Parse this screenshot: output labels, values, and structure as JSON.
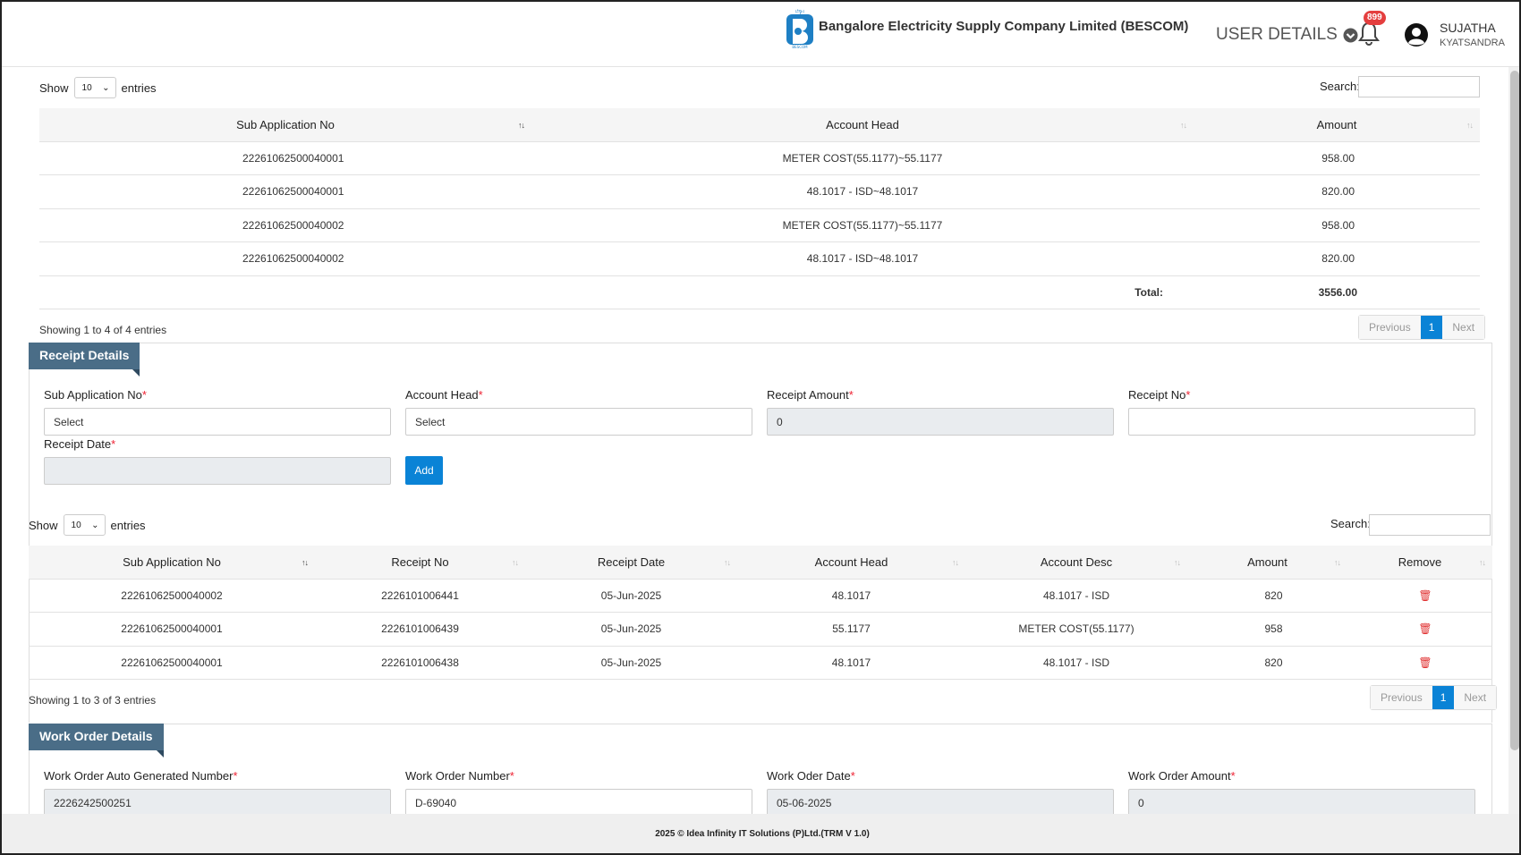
{
  "header": {
    "company": "Bangalore Electricity Supply Company Limited (BESCOM)",
    "logo_text": "BESCOM",
    "user_details": "USER DETAILS",
    "notifications": "899",
    "user_name": "SUJATHA",
    "user_location": "KYATSANDRA"
  },
  "table1": {
    "show": "Show",
    "entries": "entries",
    "page_len": "10",
    "search_label": "Search:",
    "headers": [
      "Sub Application No",
      "Account Head",
      "Amount"
    ],
    "rows": [
      [
        "22261062500040001",
        "METER COST(55.1177)~55.1177",
        "958.00"
      ],
      [
        "22261062500040001",
        "48.1017 - ISD~48.1017",
        "820.00"
      ],
      [
        "22261062500040002",
        "METER COST(55.1177)~55.1177",
        "958.00"
      ],
      [
        "22261062500040002",
        "48.1017 - ISD~48.1017",
        "820.00"
      ]
    ],
    "total_label": "Total:",
    "total_value": "3556.00",
    "info": "Showing 1 to 4 of 4 entries",
    "prev": "Previous",
    "page": "1",
    "next": "Next"
  },
  "receipt": {
    "title": "Receipt Details",
    "sub_app_label": "Sub Application No",
    "sub_app_value": "Select",
    "account_head_label": "Account Head",
    "account_head_value": "Select",
    "receipt_amount_label": "Receipt Amount",
    "receipt_amount_value": "0",
    "receipt_no_label": "Receipt No",
    "receipt_no_value": "",
    "receipt_date_label": "Receipt Date",
    "receipt_date_value": "",
    "add": "Add",
    "required": "*"
  },
  "table2": {
    "show": "Show",
    "entries": "entries",
    "page_len": "10",
    "search_label": "Search:",
    "headers": [
      "Sub Application No",
      "Receipt No",
      "Receipt Date",
      "Account Head",
      "Account Desc",
      "Amount",
      "Remove"
    ],
    "rows": [
      [
        "22261062500040002",
        "2226101006441",
        "05-Jun-2025",
        "48.1017",
        "48.1017 - ISD",
        "820"
      ],
      [
        "22261062500040001",
        "2226101006439",
        "05-Jun-2025",
        "55.1177",
        "METER COST(55.1177)",
        "958"
      ],
      [
        "22261062500040001",
        "2226101006438",
        "05-Jun-2025",
        "48.1017",
        "48.1017 - ISD",
        "820"
      ]
    ],
    "info": "Showing 1 to 3 of 3 entries",
    "prev": "Previous",
    "page": "1",
    "next": "Next"
  },
  "workorder": {
    "title": "Work Order Details",
    "auto_no_label": "Work Order Auto Generated Number",
    "auto_no_value": "2226242500251",
    "wo_no_label": "Work Order Number",
    "wo_no_value": "D-69040",
    "wo_date_label": "Work Oder Date",
    "wo_date_value": "05-06-2025",
    "wo_amount_label": "Work Order Amount",
    "wo_amount_value": "0"
  },
  "footer": "2025 © Idea Infinity IT Solutions (P)Ltd.(TRM V 1.0)",
  "colors": {
    "accent": "#0a83d6",
    "section": "#4a6d87",
    "required": "#e22233",
    "trash": "#e03030"
  }
}
